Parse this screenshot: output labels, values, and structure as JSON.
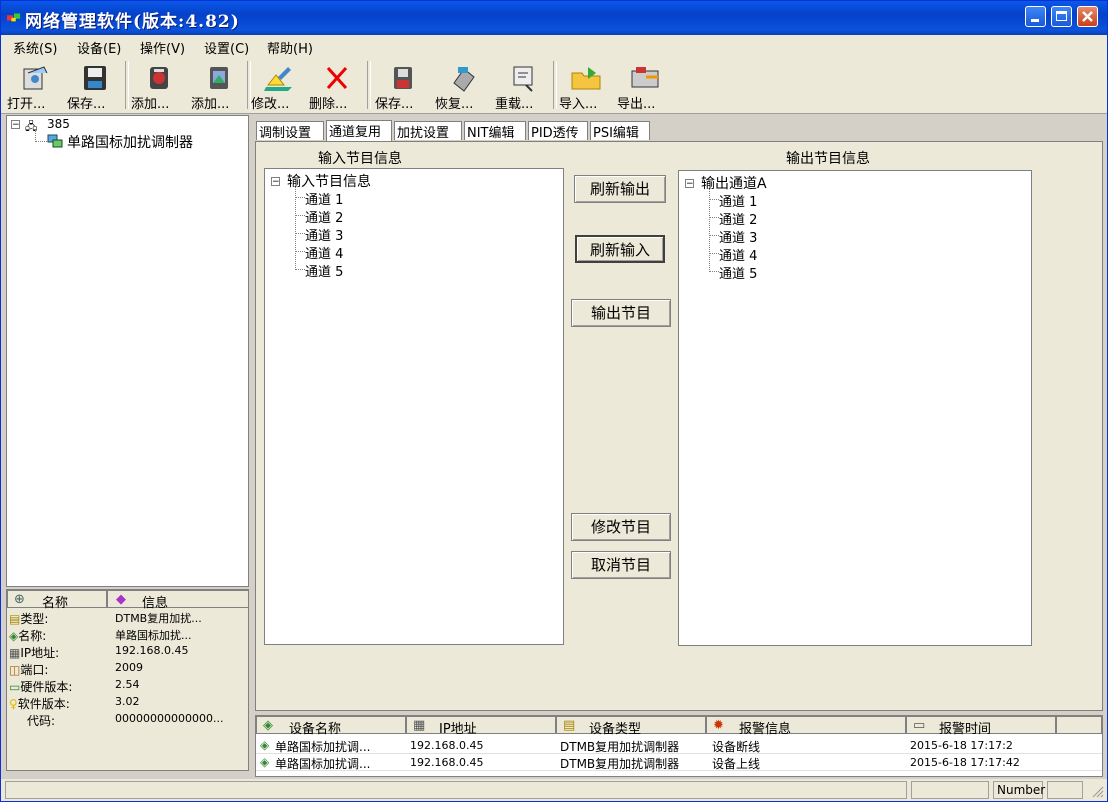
{
  "window": {
    "title": "网络管理软件(版本:4.82)"
  },
  "menu": [
    {
      "label": "系统(S)"
    },
    {
      "label": "设备(E)"
    },
    {
      "label": "操作(V)"
    },
    {
      "label": "设置(C)"
    },
    {
      "label": "帮助(H)"
    }
  ],
  "toolbar": [
    {
      "label": "打开...",
      "icon": "open-icon"
    },
    {
      "label": "保存...",
      "icon": "save-disk-icon"
    },
    {
      "label": "添加...",
      "icon": "add-device-icon"
    },
    {
      "label": "添加...",
      "icon": "add-program-icon"
    },
    {
      "label": "修改...",
      "icon": "edit-icon"
    },
    {
      "label": "删除...",
      "icon": "delete-icon"
    },
    {
      "label": "保存...",
      "icon": "save-icon"
    },
    {
      "label": "恢复...",
      "icon": "restore-icon"
    },
    {
      "label": "重载...",
      "icon": "reload-icon"
    },
    {
      "label": "导入...",
      "icon": "import-icon"
    },
    {
      "label": "导出...",
      "icon": "export-icon"
    }
  ],
  "device_tree": {
    "root": "385",
    "child": "单路国标加扰调制器"
  },
  "info_panel": {
    "col_name": "名称",
    "col_info": "信息",
    "rows": [
      {
        "key": "类型:",
        "value": "DTMB复用加扰..."
      },
      {
        "key": "名称:",
        "value": "单路国标加扰..."
      },
      {
        "key": "IP地址:",
        "value": "192.168.0.45"
      },
      {
        "key": "端口:",
        "value": "2009"
      },
      {
        "key": "硬件版本:",
        "value": "2.54"
      },
      {
        "key": "软件版本:",
        "value": "3.02"
      },
      {
        "key": "代码:",
        "value": "00000000000000..."
      }
    ]
  },
  "tabs": [
    {
      "label": "调制设置"
    },
    {
      "label": "通道复用"
    },
    {
      "label": "加扰设置"
    },
    {
      "label": "NIT编辑"
    },
    {
      "label": "PID透传"
    },
    {
      "label": "PSI编辑"
    }
  ],
  "input_section": {
    "heading": "输入节目信息",
    "root": "输入节目信息",
    "children": [
      "通道 1",
      "通道 2",
      "通道 3",
      "通道 4",
      "通道 5"
    ]
  },
  "output_section": {
    "heading": "输出节目信息",
    "root": "输出通道A",
    "children": [
      "通道 1",
      "通道 2",
      "通道 3",
      "通道 4",
      "通道 5"
    ]
  },
  "buttons": {
    "refresh_output": "刷新输出",
    "refresh_input": "刷新输入",
    "output_program": "输出节目",
    "modify_program": "修改节目",
    "cancel_program": "取消节目"
  },
  "alarm_table": {
    "headers": [
      "设备名称",
      "IP地址",
      "设备类型",
      "报警信息",
      "报警时间"
    ],
    "rows": [
      [
        "单路国标加扰调...",
        "192.168.0.45",
        "DTMB复用加扰调制器",
        "设备断线",
        "2015-6-18 17:17:2"
      ],
      [
        "单路国标加扰调...",
        "192.168.0.45",
        "DTMB复用加扰调制器",
        "设备上线",
        "2015-6-18 17:17:42"
      ]
    ]
  },
  "status": {
    "number_indicator": "Number"
  }
}
